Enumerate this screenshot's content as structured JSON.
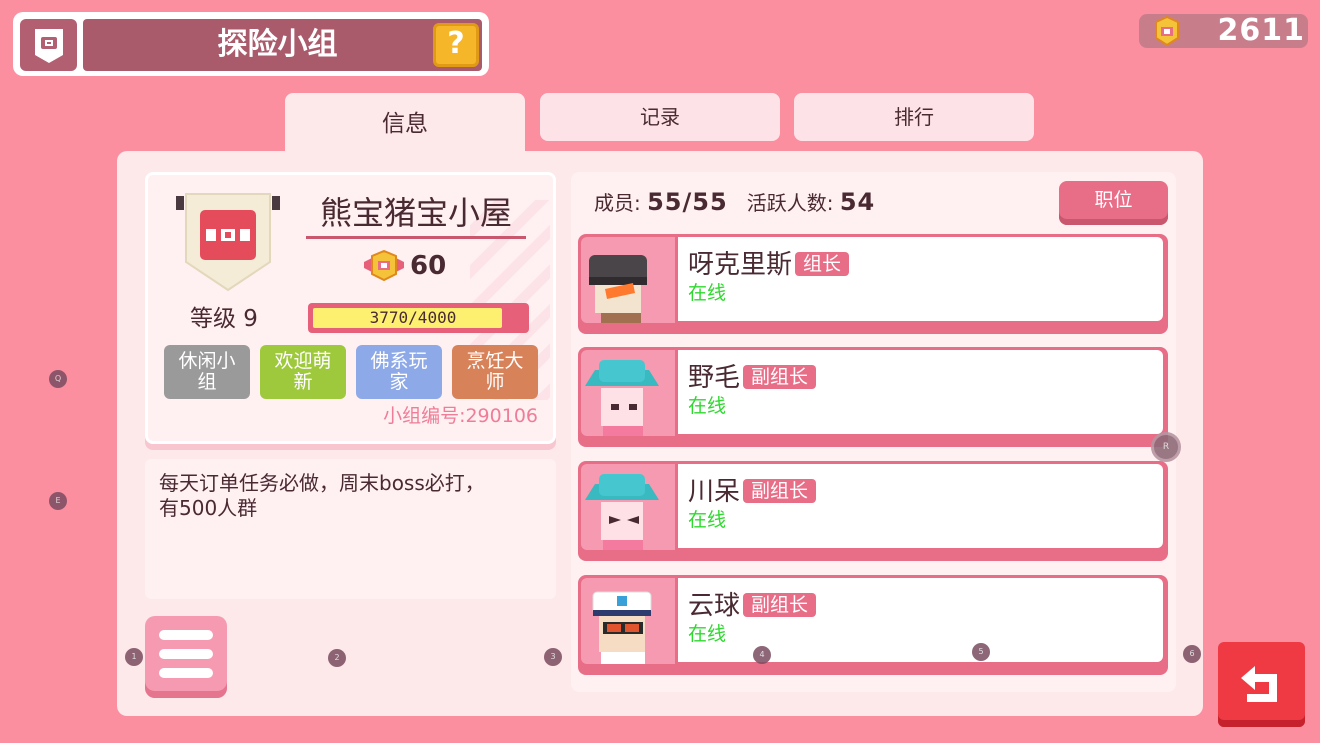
{
  "header": {
    "title": "探险小组",
    "help_label": "?"
  },
  "currency": {
    "value": "2611"
  },
  "tabs": [
    {
      "label": "信息",
      "active": true
    },
    {
      "label": "记录",
      "active": false
    },
    {
      "label": "排行",
      "active": false
    }
  ],
  "group": {
    "name": "熊宝猪宝小屋",
    "score": "60",
    "level_label": "等级 9",
    "exp_text": "3770/4000",
    "exp_progress": 0.9425,
    "tags": [
      {
        "text": "休闲小组",
        "color": "#9a9a9a"
      },
      {
        "text": "欢迎萌新",
        "color": "#9fc93d"
      },
      {
        "text": "佛系玩家",
        "color": "#8ea9e8"
      },
      {
        "text": "烹饪大师",
        "color": "#d8825a"
      }
    ],
    "id_label": "小组编号:290106",
    "description": "每天订单任务必做，周末boss必打，有500人群"
  },
  "members_header": {
    "members_label": "成员:",
    "members_value": "55/55",
    "active_label": "活跃人数:",
    "active_value": "54",
    "role_button": "职位"
  },
  "members": [
    {
      "name": "呀克里斯",
      "rank": "组长",
      "status": "在线",
      "avatar": "beanie-avatar-icon"
    },
    {
      "name": "野毛",
      "rank": "副组长",
      "status": "在线",
      "avatar": "teal-hat-avatar-icon"
    },
    {
      "name": "川呆",
      "rank": "副组长",
      "status": "在线",
      "avatar": "teal-hat-avatar-icon"
    },
    {
      "name": "云球",
      "rank": "副组长",
      "status": "在线",
      "avatar": "sailor-avatar-icon"
    }
  ],
  "hotkeys": {
    "q": "Q",
    "e": "E",
    "r": "R",
    "n1": "1",
    "n2": "2",
    "n3": "3",
    "n4": "4",
    "n5": "5",
    "n6": "6"
  },
  "colors": {
    "background": "#fb8e9f",
    "panel": "#fde8ea",
    "accent": "#e86d87",
    "online": "#2fd82f",
    "return": "#ef3a44"
  }
}
